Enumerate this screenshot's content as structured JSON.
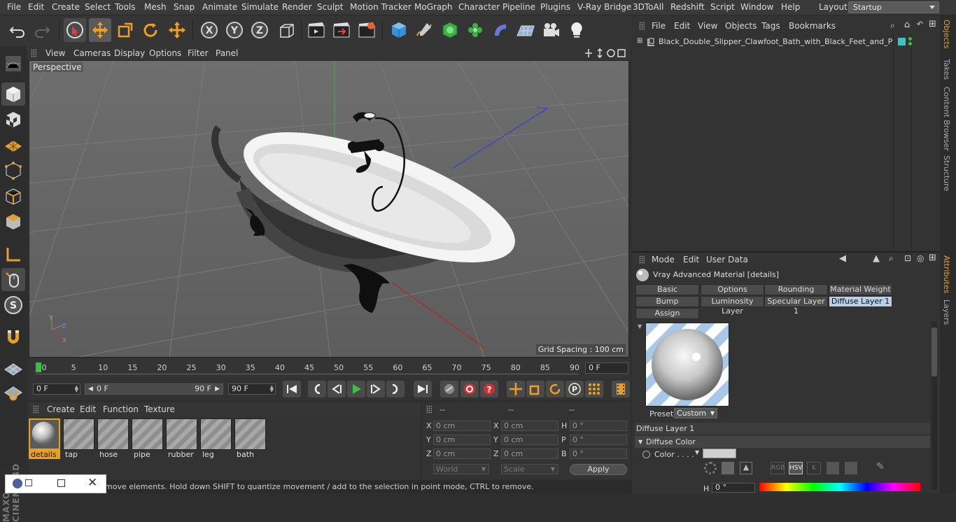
{
  "menubar": {
    "items": [
      "File",
      "Edit",
      "Create",
      "Select",
      "Tools",
      "Mesh",
      "Snap",
      "Animate",
      "Simulate",
      "Render",
      "Sculpt",
      "Motion Tracker",
      "MoGraph",
      "Character",
      "Pipeline",
      "Plugins",
      "V-Ray Bridge",
      "3DToAll",
      "Redshift",
      "Script",
      "Window",
      "Help"
    ],
    "layout_label": "Layout:",
    "layout_value": "Startup"
  },
  "viewport": {
    "menu": [
      "View",
      "Cameras",
      "Display",
      "Options",
      "Filter",
      "Panel"
    ],
    "camera_label": "Perspective",
    "grid_spacing": "Grid Spacing : 100 cm"
  },
  "timeline": {
    "ticks": [
      "0",
      "5",
      "10",
      "15",
      "20",
      "25",
      "30",
      "35",
      "40",
      "45",
      "50",
      "55",
      "60",
      "65",
      "70",
      "75",
      "80",
      "85",
      "90"
    ],
    "current_frame": "0 F"
  },
  "transport": {
    "start_field": "0 F",
    "range_start": "0 F",
    "range_end": "90 F",
    "end_field": "90 F"
  },
  "materials": {
    "menu": [
      "Create",
      "Edit",
      "Function",
      "Texture"
    ],
    "items": [
      "details",
      "tap",
      "hose",
      "pipe",
      "rubber",
      "leg",
      "bath"
    ],
    "selected": "details"
  },
  "coordinates": {
    "headers": [
      "--",
      "--",
      "--"
    ],
    "rows": [
      {
        "l1": "X",
        "v1": "0 cm",
        "l2": "X",
        "v2": "0 cm",
        "l3": "H",
        "v3": "0 °"
      },
      {
        "l1": "Y",
        "v1": "0 cm",
        "l2": "Y",
        "v2": "0 cm",
        "l3": "P",
        "v3": "0 °"
      },
      {
        "l1": "Z",
        "v1": "0 cm",
        "l2": "Z",
        "v2": "0 cm",
        "l3": "B",
        "v3": "0 °"
      }
    ],
    "world": "World",
    "scale": "Scale",
    "apply": "Apply"
  },
  "status": {
    "text": "move elements. Hold down SHIFT to quantize movement / add to the selection in point mode, CTRL to remove."
  },
  "objects": {
    "menu": [
      "File",
      "Edit",
      "View",
      "Objects",
      "Tags",
      "Bookmarks"
    ],
    "object_name": "Black_Double_Slipper_Clawfoot_Bath_with_Black_Feet_and_Plum"
  },
  "attributes": {
    "menu": [
      "Mode",
      "Edit",
      "User Data"
    ],
    "material_title": "Vray Advanced Material [details]",
    "tabs_row1": [
      "Basic",
      "Options",
      "Rounding",
      "Material Weight"
    ],
    "tabs_row2": [
      "Bump",
      "Luminosity Layer",
      "Specular Layer 1",
      "Diffuse Layer 1"
    ],
    "tabs_row3": [
      "Assign"
    ],
    "active_tab": "Diffuse Layer 1",
    "preset_label": "Preset",
    "preset_value": "Custom",
    "section_title": "Diffuse Layer 1",
    "subsection": "Diffuse Color",
    "color_label": "Color . . . .",
    "color_value": "#d0d0d0",
    "mode_buttons": [
      "RGB",
      "HSV",
      "K"
    ],
    "h_label": "H",
    "h_value": "0 °"
  },
  "sidetabs": {
    "top": [
      "Objects",
      "Takes",
      "Content Browser",
      "Structure"
    ],
    "bottom": [
      "Attributes",
      "Layers"
    ]
  },
  "colors": {
    "accent": "#e8a21c",
    "active_tab": "#b8cfe9",
    "play_green": "#3fbf3f",
    "record_red": "#d03030"
  }
}
